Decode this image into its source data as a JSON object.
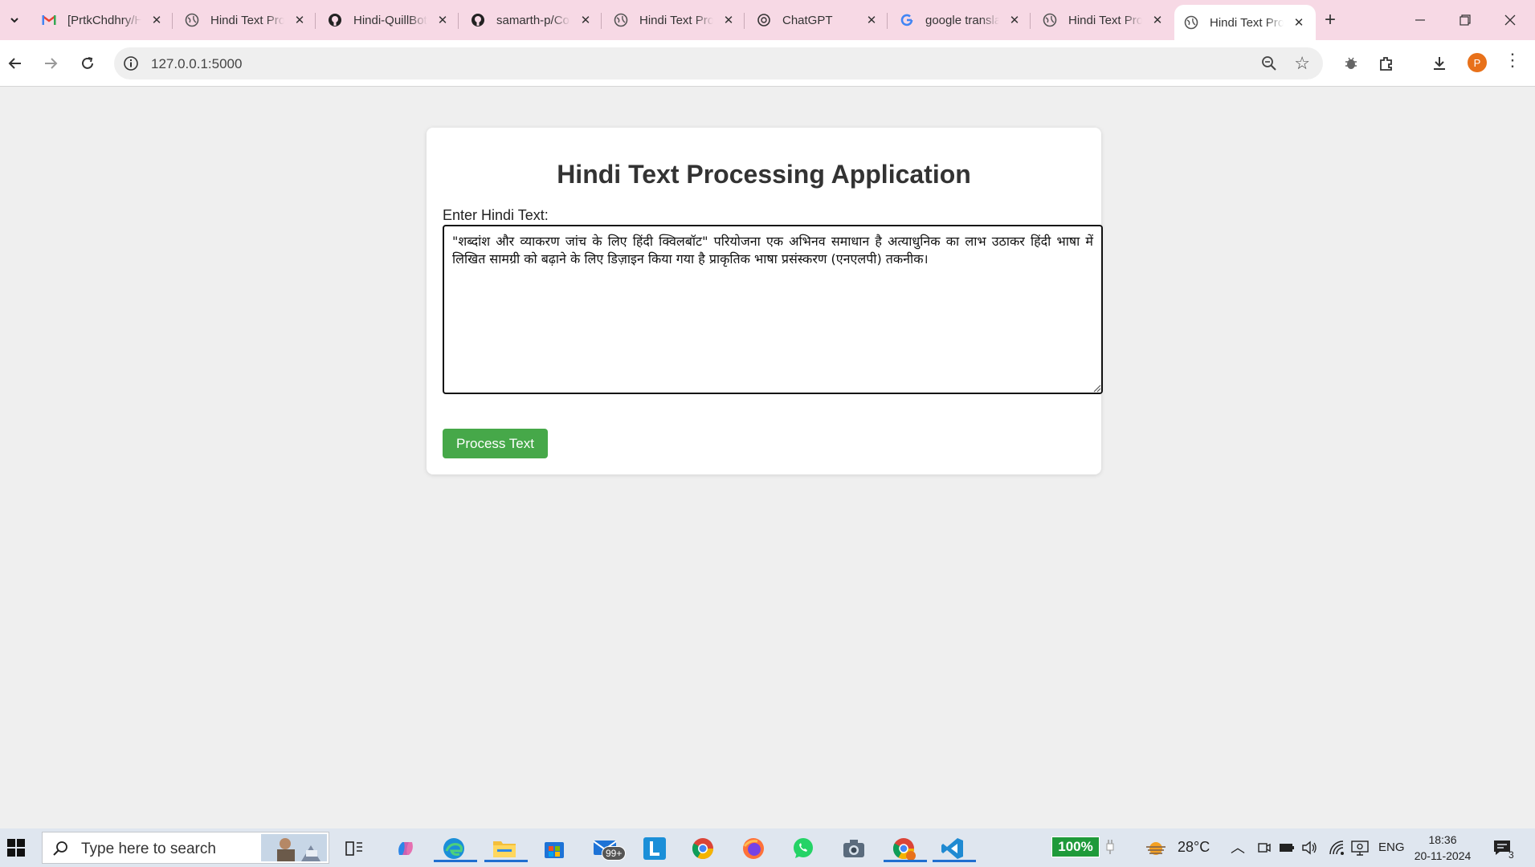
{
  "browser": {
    "tabs": [
      {
        "title": "[PrtkChdhry/Hindi",
        "icon": "gmail-icon",
        "active": false
      },
      {
        "title": "Hindi Text Processing",
        "icon": "globe-icon",
        "active": false
      },
      {
        "title": "Hindi-QuillBot",
        "icon": "github-icon",
        "active": false
      },
      {
        "title": "samarth-p/Colleges",
        "icon": "github-icon",
        "active": false
      },
      {
        "title": "Hindi Text Processing",
        "icon": "globe-icon",
        "active": false
      },
      {
        "title": "ChatGPT",
        "icon": "chatgpt-icon",
        "active": false
      },
      {
        "title": "google translate",
        "icon": "google-icon",
        "active": false
      },
      {
        "title": "Hindi Text Processing",
        "icon": "globe-icon",
        "active": false
      },
      {
        "title": "Hindi Text Processing",
        "icon": "globe-icon",
        "active": true
      }
    ],
    "close_glyph": "✕",
    "new_tab_glyph": "+",
    "url": "127.0.0.1:5000",
    "profile_initial": "P",
    "accent": "#f7d9e5"
  },
  "page": {
    "title": "Hindi Text Processing Application",
    "input_label": "Enter Hindi Text:",
    "input_value": "\"शब्दांश और व्याकरण जांच के लिए हिंदी क्विलबॉट\" परियोजना एक अभिनव समाधान है अत्याधुनिक का लाभ उठाकर हिंदी भाषा में लिखित सामग्री को बढ़ाने के लिए डिज़ाइन किया गया है प्राकृतिक भाषा प्रसंस्करण (एनएलपी) तकनीक।",
    "button_label": "Process Text",
    "button_color": "#46a849"
  },
  "taskbar": {
    "search_placeholder": "Type here to search",
    "mail_badge": "99+",
    "battery": "100%",
    "weather": "28°C",
    "language": "ENG",
    "time": "18:36",
    "date": "20-11-2024",
    "notifications": "3"
  }
}
